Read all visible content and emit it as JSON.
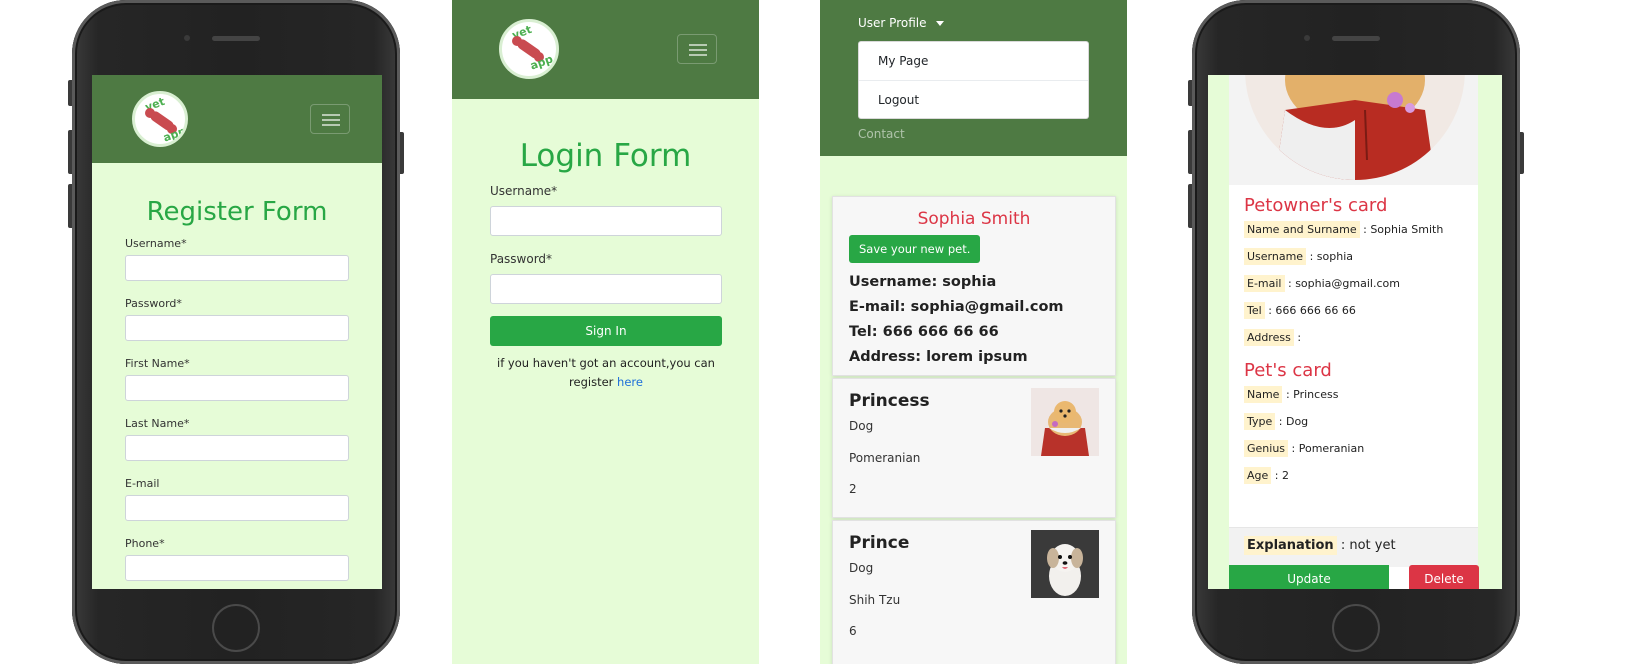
{
  "icons": {
    "logo": "vet-app-logo",
    "menu": "hamburger-icon",
    "dropdown": "caret-down-icon"
  },
  "colors": {
    "navbar": "#4e7a43",
    "page_bg": "#e6fcd7",
    "primary": "#28a745",
    "danger": "#dc3545",
    "link": "#1e6fd9"
  },
  "logo": {
    "line1": "vet",
    "line2": "app"
  },
  "register": {
    "title": "Register Form",
    "fields": [
      {
        "label": "Username*",
        "value": ""
      },
      {
        "label": "Password*",
        "value": ""
      },
      {
        "label": "First Name*",
        "value": ""
      },
      {
        "label": "Last Name*",
        "value": ""
      },
      {
        "label": "E-mail",
        "value": ""
      },
      {
        "label": "Phone*",
        "value": ""
      }
    ]
  },
  "login": {
    "title": "Login Form",
    "username_label": "Username*",
    "password_label": "Password*",
    "signin_label": "Sign In",
    "register_text": "if you haven't got an account,you can register",
    "register_link": "here"
  },
  "profile": {
    "menu": {
      "user_profile": "User Profile",
      "my_page": "My Page",
      "logout": "Logout",
      "contact": "Contact"
    },
    "owner": {
      "name": "Sophia Smith",
      "save_button": "Save your new pet.",
      "username": "Username: sophia",
      "email": "E-mail: sophia@gmail.com",
      "tel": "Tel: 666 666 66 66",
      "address": "Address: lorem ipsum"
    },
    "pets": [
      {
        "name": "Princess",
        "type": "Dog",
        "breed": "Pomeranian",
        "age": "2"
      },
      {
        "name": "Prince",
        "type": "Dog",
        "breed": "Shih Tzu",
        "age": "6"
      }
    ]
  },
  "detail": {
    "owner_title": "Petowner's card",
    "owner_fields": [
      {
        "k": "Name and Surname",
        "v": ": Sophia Smith"
      },
      {
        "k": "Username",
        "v": ": sophia"
      },
      {
        "k": "E-mail",
        "v": ": sophia@gmail.com"
      },
      {
        "k": "Tel",
        "v": ": 666 666 66 66"
      },
      {
        "k": "Address",
        "v": ":"
      }
    ],
    "pet_title": "Pet's card",
    "pet_fields": [
      {
        "k": "Name",
        "v": ": Princess"
      },
      {
        "k": "Type",
        "v": ": Dog"
      },
      {
        "k": "Genius",
        "v": ": Pomeranian"
      },
      {
        "k": "Age",
        "v": ": 2"
      }
    ],
    "explanation_key": "Explanation",
    "explanation_value": ": not yet",
    "update_label": "Update",
    "delete_label": "Delete"
  }
}
